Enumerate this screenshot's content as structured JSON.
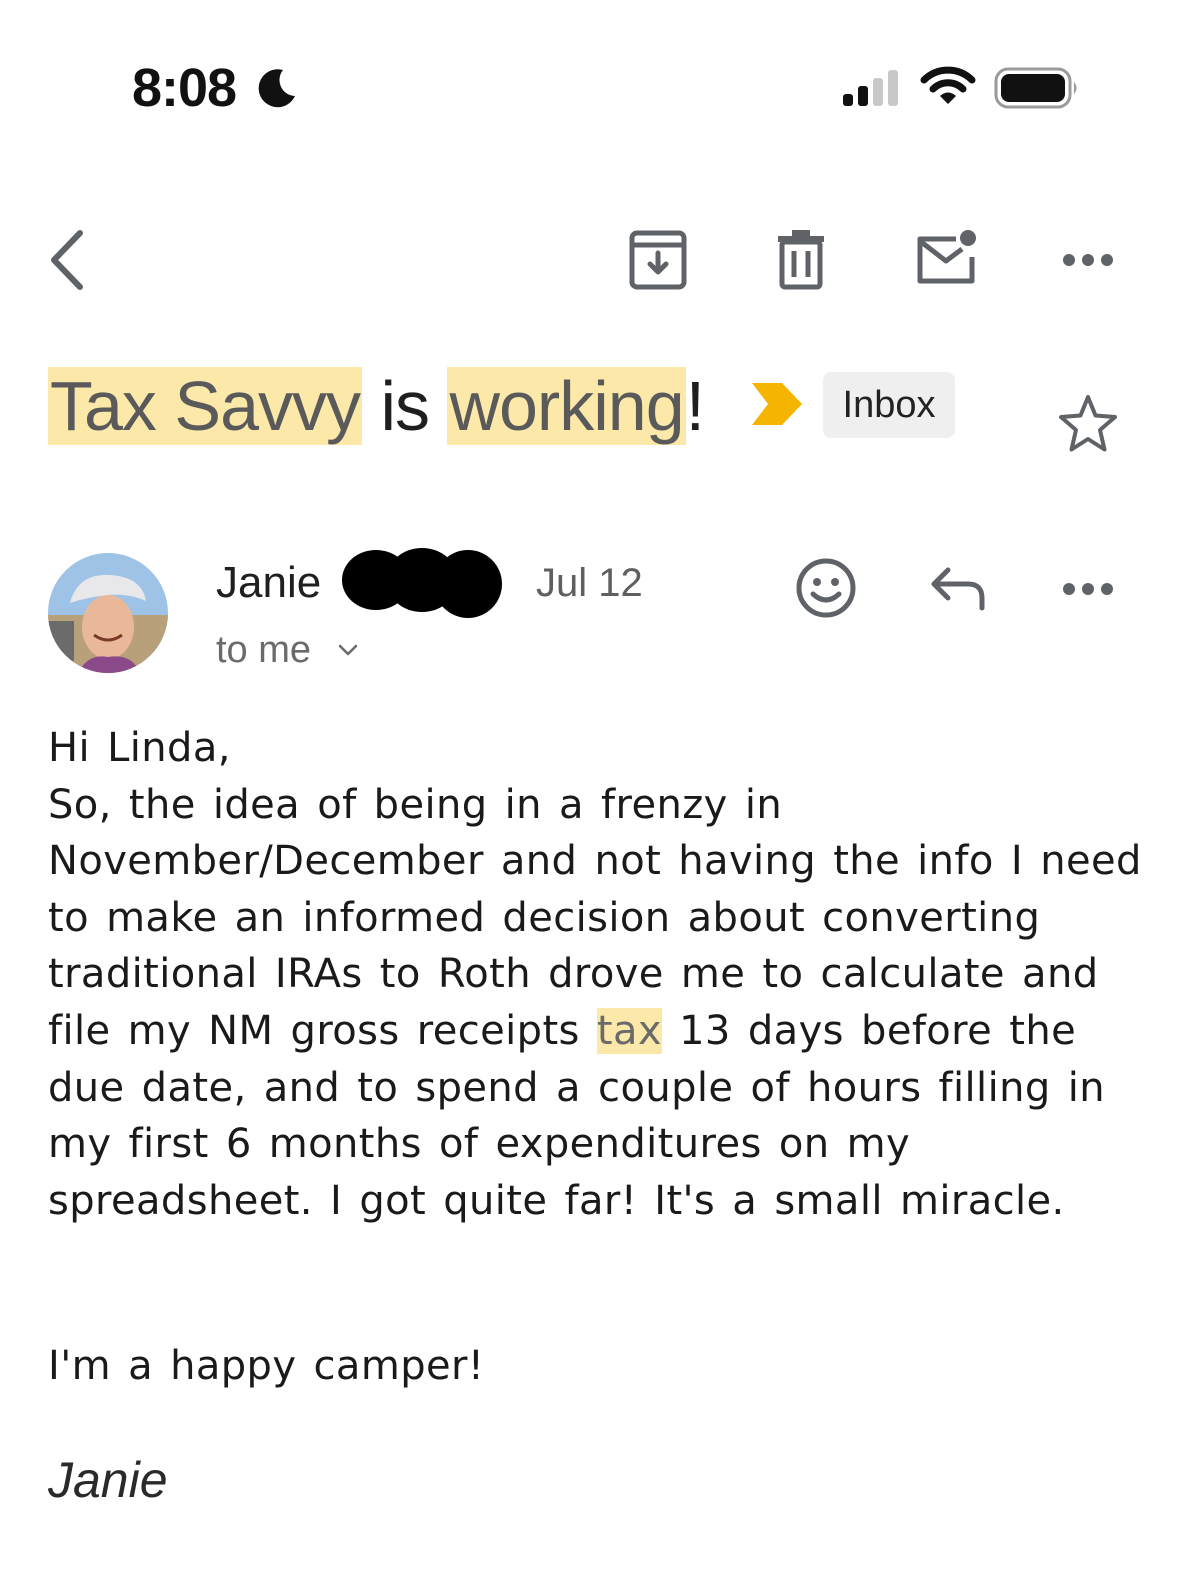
{
  "status_bar": {
    "time": "8:08",
    "focus_icon": "moon-icon",
    "signal_icon": "cellular-signal-icon",
    "wifi_icon": "wifi-icon",
    "battery_icon": "battery-icon"
  },
  "toolbar": {
    "back_icon": "chevron-left-icon",
    "archive_icon": "archive-icon",
    "delete_icon": "trash-icon",
    "mark_unread_icon": "mail-unread-icon",
    "more_icon": "more-horizontal-icon"
  },
  "subject": {
    "part1": "Tax Savvy",
    "part2": " is ",
    "part3": "working",
    "part4": "!",
    "label_chip": "Inbox",
    "importance_color": "#f4b400",
    "highlight_color": "#fce8a8"
  },
  "message": {
    "sender_first_name": "Janie",
    "date": "Jul 12",
    "recipient": "to me",
    "react_icon": "smiley-icon",
    "reply_icon": "reply-icon",
    "more_icon": "more-horizontal-icon",
    "greeting": "Hi Linda,",
    "body_before": "So, the idea of being in a frenzy in November/December and not having the info I need to make an informed decision about converting traditional IRAs to Roth drove me to calculate and file my NM gross receipts ",
    "body_highlight": "tax",
    "body_after": " 13 days before the due date, and to spend a couple of hours filling in my first 6 months of expenditures on my spreadsheet. I got quite far! It's a small miracle.",
    "closing": "I'm a happy camper!",
    "signature": "Janie"
  }
}
